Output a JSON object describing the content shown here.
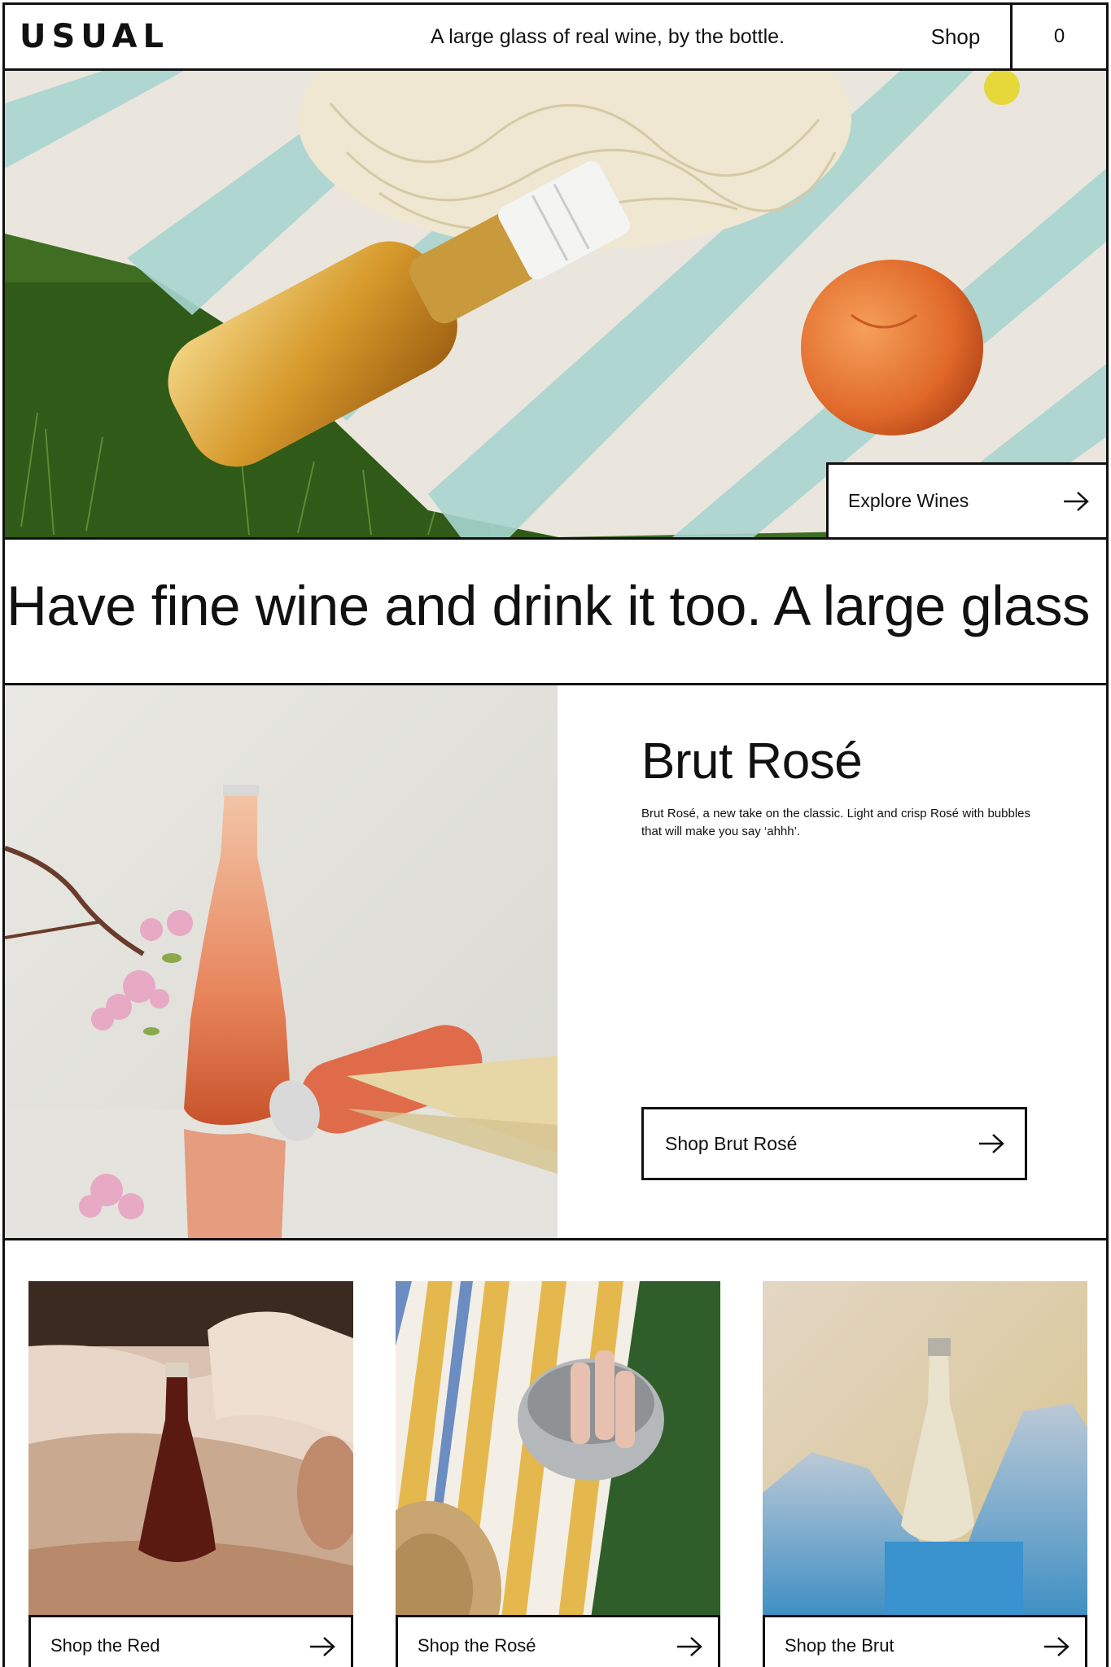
{
  "header": {
    "logo": "USUAL",
    "tagline": "A large glass of real wine, by the bottle.",
    "shop_label": "Shop",
    "cart_count": "0"
  },
  "hero": {
    "cta_label": "Explore Wines",
    "cta_icon": "arrow-right-icon"
  },
  "marquee": {
    "text": "Have fine wine and drink it too. A large glass of real wine, by the bottle."
  },
  "feature": {
    "title": "Brut Rosé",
    "description": "Brut Rosé, a new take on the classic. Light and crisp Rosé with bubbles that will make you say ‘ahhh’.",
    "cta_label": "Shop Brut Rosé"
  },
  "cards": [
    {
      "label": "Shop the Red"
    },
    {
      "label": "Shop the Rosé"
    },
    {
      "label": "Shop the Brut"
    }
  ],
  "colors": {
    "border": "#111111",
    "background": "#ffffff",
    "towel_stripe": "#a9d5cf",
    "grass": "#3a6b1f",
    "peach": "#e8783a",
    "rose": "#e58a68"
  }
}
